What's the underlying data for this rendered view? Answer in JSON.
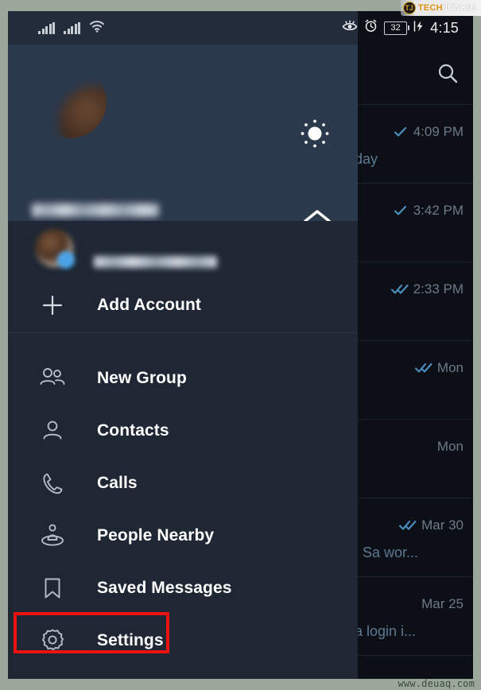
{
  "watermarks": {
    "brand_badge": "TJ",
    "brand_part1": "TECH",
    "brand_part2": "JUNKIE",
    "footer_url": "www.deuaq.com"
  },
  "status_bar": {
    "signal_1": "cellular-signal-icon",
    "signal_2": "cellular-signal-icon",
    "wifi": "wifi-icon",
    "eye_icon": "eye-icon",
    "alarm_icon": "alarm-clock-icon",
    "battery_level": "32",
    "charging_icon": "charging-bolt-icon",
    "time": "4:15"
  },
  "drawer": {
    "profile": {
      "avatar": "user-avatar-blurred",
      "name": "",
      "phone": "",
      "theme_toggle_icon": "sun-icon",
      "expand_icon": "chevron-up-icon"
    },
    "accounts": [
      {
        "avatar": "account-avatar-blurred",
        "name": "",
        "badge": "account-badge"
      }
    ],
    "add_account": {
      "icon": "plus-icon",
      "label": "Add Account"
    },
    "menu": [
      {
        "icon": "people-group-icon",
        "label": "New Group",
        "highlighted": false
      },
      {
        "icon": "person-icon",
        "label": "Contacts",
        "highlighted": false
      },
      {
        "icon": "phone-icon",
        "label": "Calls",
        "highlighted": false
      },
      {
        "icon": "people-nearby-icon",
        "label": "People Nearby",
        "highlighted": false
      },
      {
        "icon": "bookmark-icon",
        "label": "Saved Messages",
        "highlighted": false
      },
      {
        "icon": "gear-icon",
        "label": "Settings",
        "highlighted": true
      }
    ]
  },
  "chat_list": {
    "search_icon": "search-icon",
    "rows": [
      {
        "ticks": "single-check",
        "time": "4:09 PM",
        "preview": "day"
      },
      {
        "ticks": "single-check",
        "time": "3:42 PM",
        "preview": ""
      },
      {
        "ticks": "double-check",
        "time": "2:33 PM",
        "preview": ""
      },
      {
        "ticks": "double-check",
        "time": "Mon",
        "preview": ""
      },
      {
        "ticks": "none",
        "time": "Mon",
        "preview": ""
      },
      {
        "ticks": "double-check",
        "time": "Mar 30",
        "preview": ". Sa wor..."
      },
      {
        "ticks": "none",
        "time": "Mar 25",
        "preview": "a login i..."
      }
    ]
  },
  "colors": {
    "drawer_header": "#2b394d",
    "drawer_body": "#1e2733",
    "chat_bg": "#0c1016",
    "status_bar": "#222c3a",
    "highlight_red": "#ee1111",
    "tick_blue": "#4c8fc0",
    "preview_blue": "#5d7a93",
    "frame_border": "#9aa79a"
  }
}
